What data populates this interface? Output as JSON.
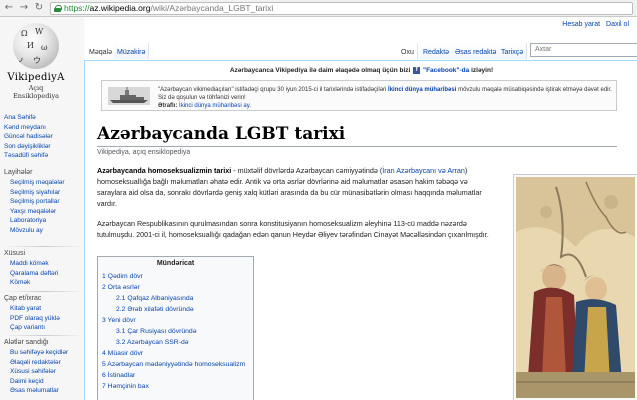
{
  "browser": {
    "url_protocol": "https://",
    "url_host": "az.wikipedia.org",
    "url_path": "/wiki/Azərbaycanda_LGBT_tarixi"
  },
  "logo": {
    "wordmark": "VikipediyA",
    "tagline": "Açıq Ensiklopediya"
  },
  "personal": {
    "create_account": "Hesab yarat",
    "login": "Daxil ol"
  },
  "tabs": {
    "article": "Məqalə",
    "talk": "Müzakirə",
    "read": "Oxu",
    "edit": "Redaktə",
    "edit_source": "Əsas redaktə",
    "history": "Tarixçə",
    "search_placeholder": "Axtar"
  },
  "sidebar": {
    "main": [
      "Ana Səhifə",
      "Kənd meydanı",
      "Güncəl hadisələr",
      "Son dəyişikliklər",
      "Təsadüfi səhifə"
    ],
    "layiheler_head": "Layihələr",
    "layiheler": [
      "Seçilmiş məqalələr",
      "Seçilmiş siyahılar",
      "Seçilmiş portallar",
      "Yaxşı məqalələr",
      "Laboratoriya",
      "Mövzulu ay"
    ],
    "xususi_head": "Xüsusi",
    "xususi": [
      "Maddi kömək",
      "Qaralama dəftəri",
      "Kömək"
    ],
    "cap_head": "Çap et/ixrac",
    "cap": [
      "Kitab yarat",
      "PDF olaraq yüklə",
      "Çap variantı"
    ],
    "aletler_head": "Alətlər sandığı",
    "aletler": [
      "Bu səhifəyə keçidlər",
      "Əlaqəli redaktələr",
      "Xüsusi səhifələr",
      "Daimi keçid",
      "Əsas məlumatlar"
    ]
  },
  "sitenotice": {
    "text": "Azərbaycanca Vikipediya ilə daim əlaqədə olmaq üçün bizi",
    "link": "\"Facebook\"-da",
    "suffix": "izləyin!"
  },
  "banner": {
    "line1_a": "\"Azərbaycan vikimediaçıları\" istifadəçi qrupu 30 iyun 2015-ci il tarixlərində istifadəçiləri",
    "line1_link": "İkinci dünya müharibəsi",
    "line1_b": "mövzulu məqalə müsabiqəsində iştirak etməyə dəvət edir. Siz də qoşulun və töhfənizi verin!",
    "line2_label": "Ətraflı:",
    "line2_link": "İkinci dünya müharibəsi ay."
  },
  "article": {
    "title": "Azərbaycanda LGBT tarixi",
    "subtitle": "Vikipediya, açıq ensiklopediya",
    "p1_bold": "Azərbaycanda homoseksualizmin tarixi",
    "p1_a": " - müxtəlif dövrlərdə Azərbaycan cəmiyyətində (",
    "p1_link": "İran Azərbaycanı və Arran",
    "p1_b": ") homoseksuallığa bağlı məlumatları əhatə edir. Antik və orta əsrlər dövrlərinə aid məlumatlar əsasən hakim təbəqə və saraylara aid olsa da, sonrakı dövrlərdə geniş xalq kütləri arasında da bu cür münasibətlərin olması haqqında məlumatlar vardır.",
    "p2": "Azərbaycan Respublikasının qurulmasından sonra konstitusiyanın homoseksualizm əleyhinə 113-cü maddə nəzərdə tutulmuşdu. 2001-ci il, homoseksuallığı qadağan edən qanun Heydər Əliyev tərəfindən Cinayət Məcəlləsindən çıxarılmışdır."
  },
  "toc": {
    "title": "Mündəricat",
    "items": [
      {
        "text": "1 Qədim dövr",
        "level": 1
      },
      {
        "text": "2 Orta əsrlər",
        "level": 1
      },
      {
        "text": "2.1 Qafqaz Albaniyasında",
        "level": 2
      },
      {
        "text": "2.2 Ərəb xilafəti dövründə",
        "level": 2
      },
      {
        "text": "3 Yeni dövr",
        "level": 1
      },
      {
        "text": "3.1 Çar Rusiyası dövründə",
        "level": 2
      },
      {
        "text": "3.2 Azərbaycan SSR-də",
        "level": 2
      },
      {
        "text": "4 Müasir dövr",
        "level": 1
      },
      {
        "text": "5 Azərbaycan mədəniyyətində homoseksualizm",
        "level": 1
      },
      {
        "text": "6 İstinadlar",
        "level": 1
      },
      {
        "text": "7 Həmçinin bax",
        "level": 1
      }
    ]
  }
}
